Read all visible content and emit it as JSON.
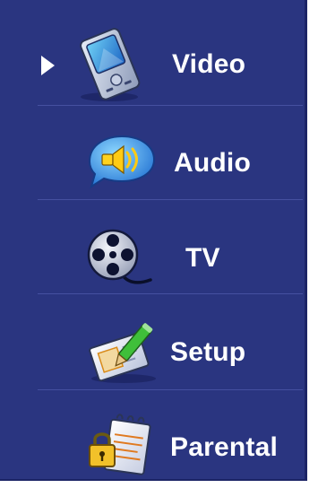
{
  "menu": {
    "selected_index": 0,
    "items": [
      {
        "label": "Video",
        "icon": "video-player-icon"
      },
      {
        "label": "Audio",
        "icon": "speaker-bubble-icon"
      },
      {
        "label": "TV",
        "icon": "film-reel-icon"
      },
      {
        "label": "Setup",
        "icon": "setup-pencil-icon"
      },
      {
        "label": "Parental",
        "icon": "parental-lock-icon"
      }
    ]
  },
  "colors": {
    "background": "#2a3580",
    "text": "#ffffff",
    "separator": "#4a55a6"
  }
}
